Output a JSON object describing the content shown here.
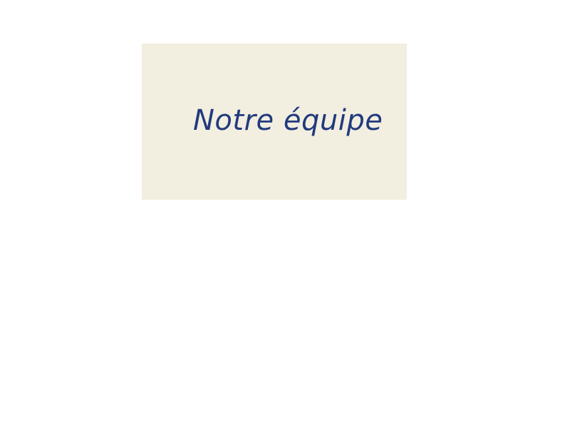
{
  "team_header": {
    "title": "Notre équipe"
  },
  "colors": {
    "card_background": "#f2eee0",
    "title_text": "#213a7d",
    "page_background": "#ffffff"
  }
}
